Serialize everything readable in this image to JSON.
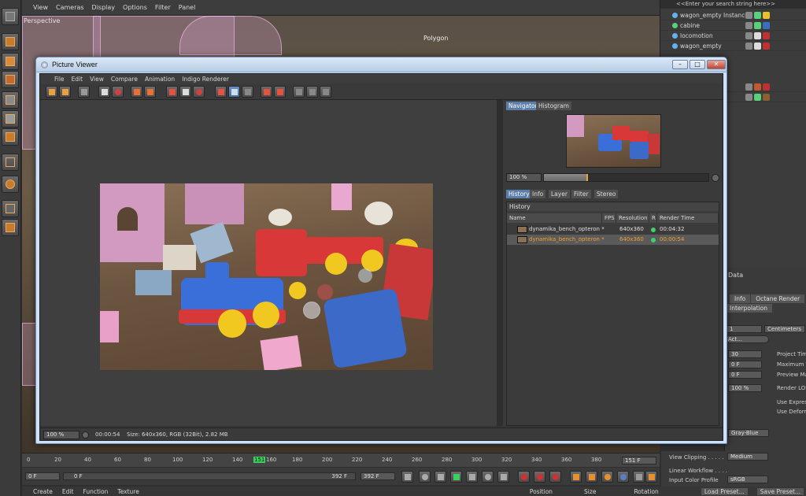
{
  "viewport": {
    "menu": [
      "View",
      "Cameras",
      "Display",
      "Options",
      "Filter",
      "Panel"
    ],
    "label": "Perspective",
    "polygon_label": "Polygon"
  },
  "object_manager": {
    "search_placeholder": "<<Enter your search string here>>",
    "objects": [
      {
        "name": "wagon_empty Instance"
      },
      {
        "name": "cabine"
      },
      {
        "name": "locomotion"
      },
      {
        "name": "wagon_empty"
      }
    ]
  },
  "picture_viewer": {
    "title": "Picture Viewer",
    "menu": [
      "File",
      "Edit",
      "View",
      "Compare",
      "Animation",
      "Indigo Renderer"
    ],
    "tabs_top": [
      "Navigator",
      "Histogram"
    ],
    "tabs_bottom": [
      "History",
      "Info",
      "Layer",
      "Filter",
      "Stereo"
    ],
    "nav_zoom": "100 %",
    "nav_zoom_fraction": 0.26,
    "history": {
      "header": "History",
      "columns": [
        "Name",
        "FPS",
        "Resolution",
        "R",
        "Render Time"
      ],
      "rows": [
        {
          "name": "dynamika_bench_opteron *",
          "resolution": "640x360",
          "render_time": "00:04:32",
          "selected": false
        },
        {
          "name": "dynamika_bench_opteron *",
          "resolution": "640x360",
          "render_time": "00:00:54",
          "selected": true
        }
      ]
    },
    "status": {
      "zoom": "100 %",
      "time": "00:00:54",
      "size": "Size: 640x360, RGB (32Bit), 2.82 MB"
    }
  },
  "attributes": {
    "title": "Data",
    "tabs": [
      "Info",
      "Octane Render"
    ],
    "interpolation_tab": "Interpolation",
    "units_value": "1",
    "units_select": "Centimeters",
    "preset_btn": "Act...",
    "fps": "30",
    "min_time": "0 F",
    "preview_min": "0 F",
    "lod": "100 %",
    "labels": [
      "Project Tim",
      "Maximum T",
      "Preview Ma",
      "Render LOI",
      "Use Expres",
      "Use Deform"
    ],
    "color": "Gray-Blue"
  },
  "timeline": {
    "ticks": [
      "0",
      "20",
      "40",
      "60",
      "80",
      "100",
      "120",
      "140",
      "151",
      "160",
      "180",
      "200",
      "220",
      "240",
      "260",
      "280",
      "300",
      "320",
      "340",
      "360",
      "380"
    ],
    "end_frame": "151 F",
    "current_frame": "151",
    "start_field": "0 F",
    "range_start": "0 F",
    "range_end": "392 F",
    "max_field": "392 F"
  },
  "color_management": {
    "view_clipping_label": "View Clipping . . . . .",
    "view_clipping_value": "Medium",
    "linear_workflow_label": "Linear Workflow . . . .",
    "input_color_label": "Input Color Profile",
    "input_color_value": "sRGB",
    "load_preset": "Load Preset...",
    "save_preset": "Save Preset..."
  },
  "bottom_menu": [
    "Create",
    "Edit",
    "Function",
    "Texture"
  ],
  "bottom_panel": [
    "Position",
    "Size",
    "Rotation"
  ]
}
